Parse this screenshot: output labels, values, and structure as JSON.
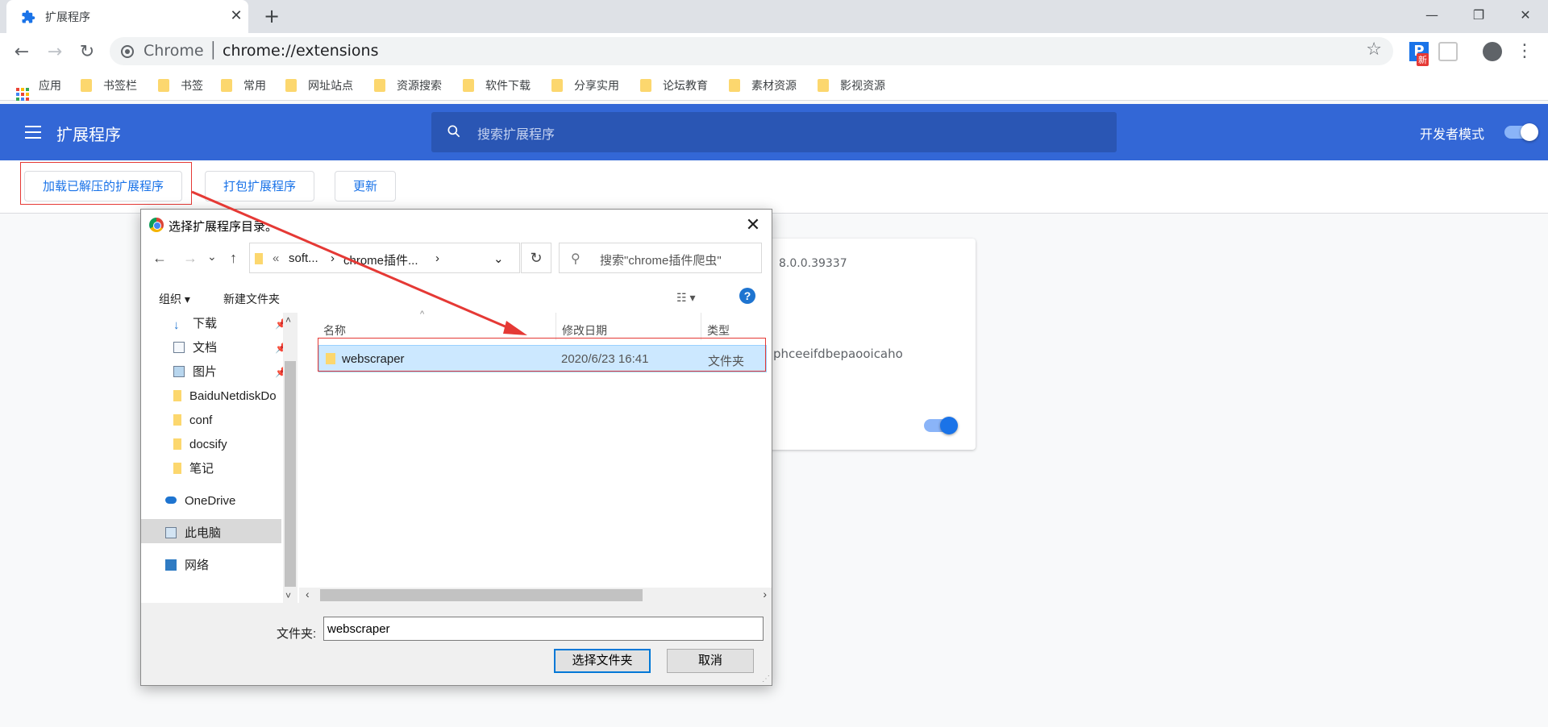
{
  "browser": {
    "tab_title": "扩展程序",
    "tab_close": "✕",
    "new_tab": "+",
    "window": {
      "minimize": "—",
      "maximize": "❐",
      "close": "✕"
    },
    "nav": {
      "back": "←",
      "forward": "→",
      "reload": "↻"
    },
    "omnibox": {
      "scheme": "Chrome │ ",
      "url": "chrome://extensions"
    },
    "star": "☆",
    "ext_badge": "新",
    "ext_p": "P",
    "menu": "⋮"
  },
  "bookmarks": [
    "应用",
    "书签栏",
    "书签",
    "常用",
    "网址站点",
    "资源搜索",
    "软件下载",
    "分享实用",
    "论坛教育",
    "素材资源",
    "影视资源"
  ],
  "extensions_page": {
    "title": "扩展程序",
    "search_placeholder": "搜索扩展程序",
    "dev_mode_label": "开发者模式",
    "dev_mode_on": true,
    "buttons": {
      "load_unpacked": "加载已解压的扩展程序",
      "pack": "打包扩展程序",
      "update": "更新"
    },
    "card": {
      "version": "8.0.0.39337",
      "id_fragment": "phceeifdbepaooicaho",
      "enabled": true
    }
  },
  "dialog": {
    "title": "选择扩展程序目录。",
    "close": "✕",
    "nav": {
      "back": "←",
      "forward": "→",
      "recent": "⌄",
      "up": "↑"
    },
    "breadcrumb": [
      "«",
      "soft...",
      "›",
      "chrome插件...",
      "›"
    ],
    "breadcrumb_dropdown": "⌄",
    "refresh": "↻",
    "search_placeholder": "搜索\"chrome插件爬虫\"",
    "search_icon": "⚲",
    "organize": "组织 ▾",
    "new_folder": "新建文件夹",
    "view_toggle": "☷ ▾",
    "help": "?",
    "nav_pane": [
      {
        "label": "下载",
        "pinned": true
      },
      {
        "label": "文档",
        "pinned": true
      },
      {
        "label": "图片",
        "pinned": true
      },
      {
        "label": "BaiduNetdiskDo",
        "pinned": false
      },
      {
        "label": "conf",
        "pinned": false
      },
      {
        "label": "docsify",
        "pinned": false
      },
      {
        "label": "笔记",
        "pinned": false
      },
      {
        "label": "OneDrive",
        "pinned": false
      },
      {
        "label": "此电脑",
        "pinned": false
      },
      {
        "label": "网络",
        "pinned": false
      }
    ],
    "pin_glyph": "📌",
    "columns": {
      "name": "名称",
      "modified": "修改日期",
      "type": "类型",
      "sort_caret": "^"
    },
    "files": [
      {
        "name": "webscraper",
        "modified": "2020/6/23 16:41",
        "type": "文件夹"
      }
    ],
    "folder_label": "文件夹:",
    "folder_value": "webscraper",
    "select_button": "选择文件夹",
    "cancel_button": "取消",
    "scroll": {
      "up": "˄",
      "down": "˅",
      "left": "‹",
      "right": "›"
    }
  },
  "colors": {
    "header_blue": "#3367d6",
    "search_blue": "#2a56b4",
    "link_blue": "#1a73e8",
    "annotation_red": "#e53935",
    "selection": "#cce8ff"
  }
}
